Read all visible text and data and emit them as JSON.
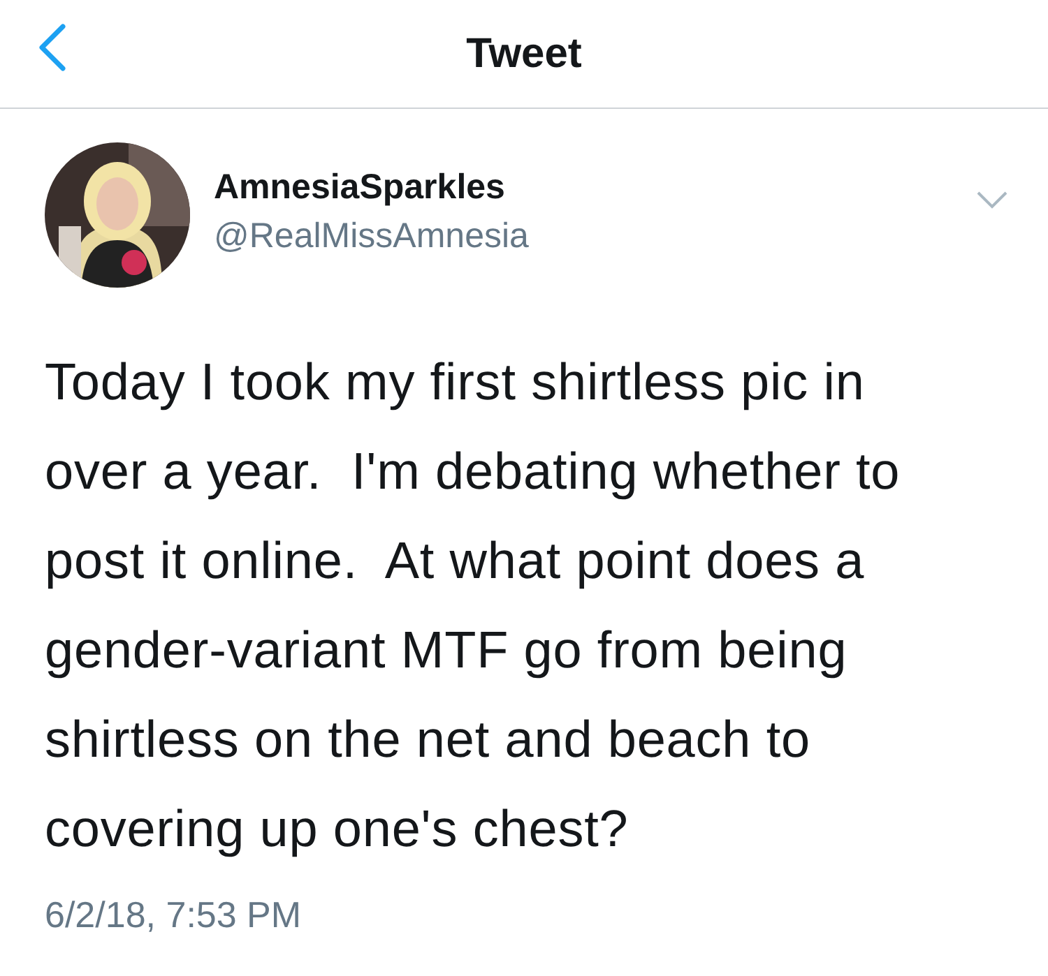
{
  "header": {
    "title": "Tweet"
  },
  "tweet": {
    "author": {
      "name": "AmnesiaSparkles",
      "handle": "@RealMissAmnesia"
    },
    "text": "Today I took my first shirtless pic in over a year.  I'm debating whether to post it online.  At what point does a gender-variant MTF go from being shirtless on the net and beach to covering up one's chest?",
    "timestamp": "6/2/18, 7:53 PM"
  }
}
